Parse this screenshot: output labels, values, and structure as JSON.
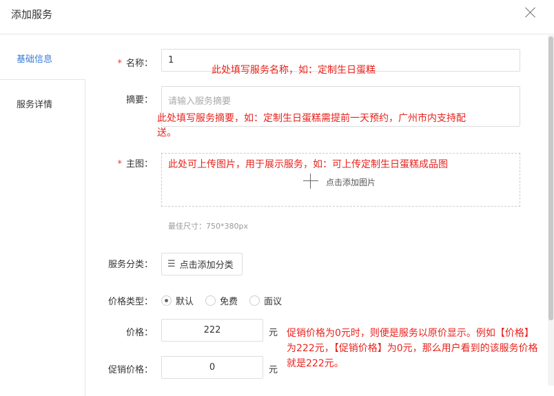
{
  "dialog": {
    "title": "添加服务"
  },
  "sidebar": {
    "items": [
      {
        "label": "基础信息",
        "active": true
      },
      {
        "label": "服务详情",
        "active": false
      }
    ]
  },
  "form": {
    "name": {
      "label": "名称：",
      "required": "*",
      "value": "1"
    },
    "summary": {
      "label": "摘要：",
      "placeholder": "请输入服务摘要"
    },
    "main_image": {
      "label": "主图：",
      "required": "*",
      "add_label": "点击添加图片",
      "hint": "最佳尺寸：750*380px"
    },
    "category": {
      "label": "服务分类：",
      "button": "点击添加分类"
    },
    "price_type": {
      "label": "价格类型：",
      "options": [
        "默认",
        "免费",
        "面议"
      ],
      "selected": "默认"
    },
    "price": {
      "label": "价格：",
      "value": "222",
      "unit": "元"
    },
    "promo_price": {
      "label": "促销价格：",
      "value": "0",
      "unit": "元"
    }
  },
  "notes": {
    "name": "此处填写服务名称，如：定制生日蛋糕",
    "summary": "此处填写服务摘要，如：定制生日蛋糕需提前一天预约，广州市内支持配送。",
    "image": "此处可上传图片，用于展示服务，如：可上传定制生日蛋糕成品图",
    "price": "促销价格为0元时，则便是服务以原价显示。例如【价格】为222元，【促销价格】为0元，那么用户看到的该服务价格就是222元。"
  },
  "colors": {
    "accent": "#3a7bd5",
    "note": "#e8221c"
  }
}
